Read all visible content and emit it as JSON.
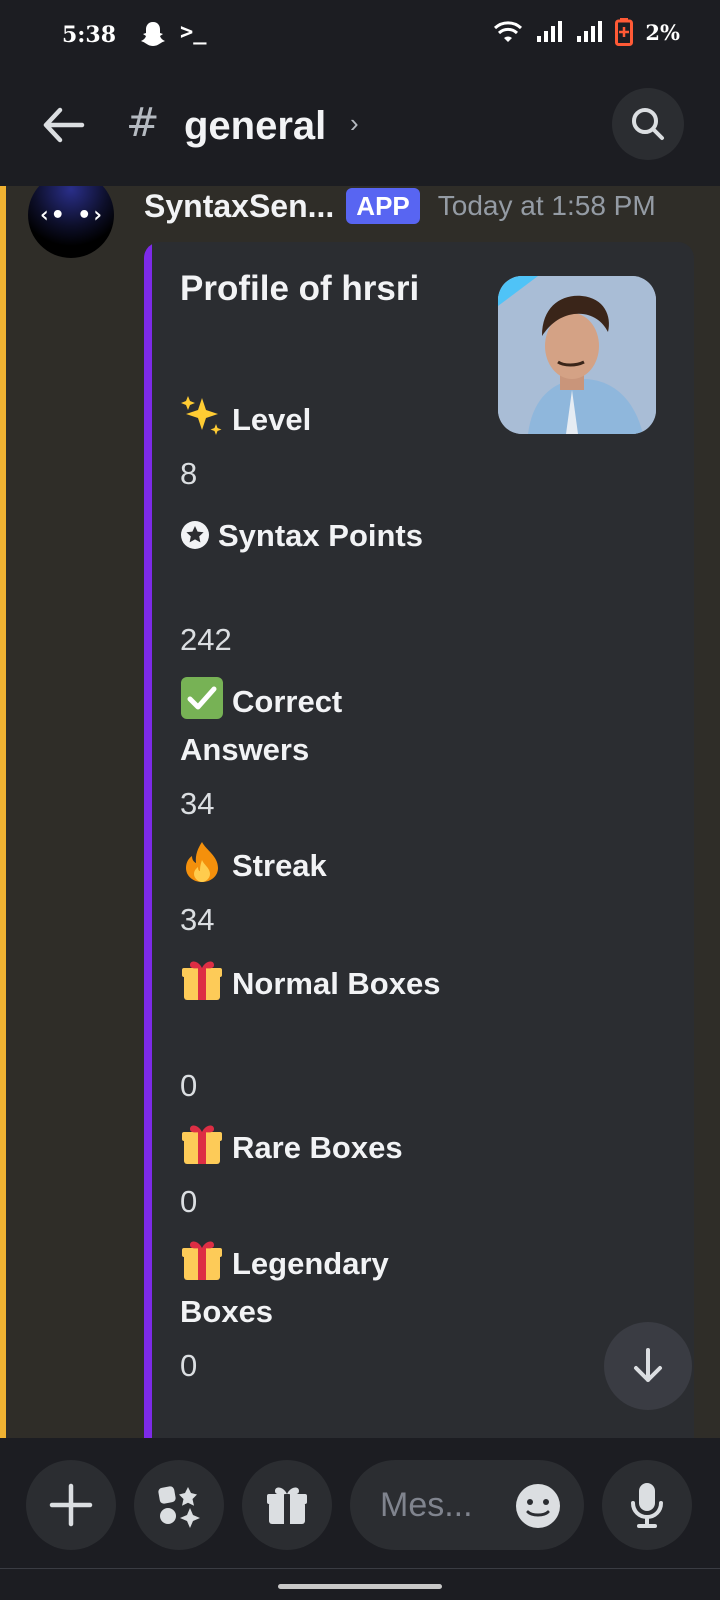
{
  "status_bar": {
    "time": "5:38",
    "terminal_glyph": ">_",
    "battery_text": "2%"
  },
  "header": {
    "hash": "#",
    "channel": "general",
    "chevron": "›"
  },
  "message": {
    "avatar_text": "‹• •›",
    "author": "SyntaxSen...",
    "badge": "APP",
    "timestamp": "Today at 1:58 PM"
  },
  "embed": {
    "title": "Profile of hrsri",
    "fields": [
      {
        "icon": "sparkles-icon",
        "name": "Level",
        "value": "8"
      },
      {
        "icon": "star-circle-icon",
        "name": "Syntax Points",
        "value": "242"
      },
      {
        "icon": "check-mark-icon",
        "name": "Correct Answers",
        "value": "34"
      },
      {
        "icon": "fire-icon",
        "name": "Streak",
        "value": "34"
      },
      {
        "icon": "gift-icon",
        "name": "Normal Boxes",
        "value": "0"
      },
      {
        "icon": "gift-icon",
        "name": "Rare Boxes",
        "value": "0"
      },
      {
        "icon": "gift-icon",
        "name": "Legendary Boxes",
        "value": "0"
      }
    ],
    "accent_color": "#7d2ae8"
  },
  "composer": {
    "placeholder": "Mes..."
  },
  "colors": {
    "highlight": "#f0b232",
    "badge": "#5865f2",
    "battery": "#ff5a36"
  }
}
